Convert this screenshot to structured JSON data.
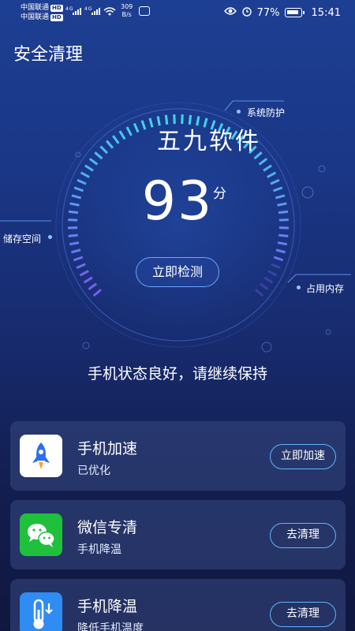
{
  "status_bar": {
    "carrier1": "中国联通",
    "carrier2": "中国联通",
    "hd": "HD",
    "net_speed_value": "309",
    "net_speed_unit": "B/s",
    "battery": "77%",
    "time": "15:41"
  },
  "header": {
    "title": "安全清理"
  },
  "gauge": {
    "watermark": "五九软件",
    "score": "93",
    "unit": "分",
    "check_button": "立即检测",
    "labels": {
      "system": "系统防护",
      "storage": "储存空间",
      "memory": "占用内存"
    },
    "score_fraction": 0.93
  },
  "status_text": "手机状态良好，请继续保持",
  "cards": [
    {
      "title": "手机加速",
      "subtitle": "已优化",
      "action": "立即加速",
      "icon": "rocket-icon"
    },
    {
      "title": "微信专清",
      "subtitle": "手机降温",
      "action": "去清理",
      "icon": "wechat-icon"
    },
    {
      "title": "手机降温",
      "subtitle": "降低手机温度",
      "action": "去清理",
      "icon": "thermometer-icon"
    }
  ],
  "colors": {
    "background_top": "#1d3f93",
    "background_bottom": "#10173f",
    "accent_cyan": "#3fd6f3",
    "accent_purple": "#7a5cf0",
    "button_border": "#5eb6ff"
  }
}
